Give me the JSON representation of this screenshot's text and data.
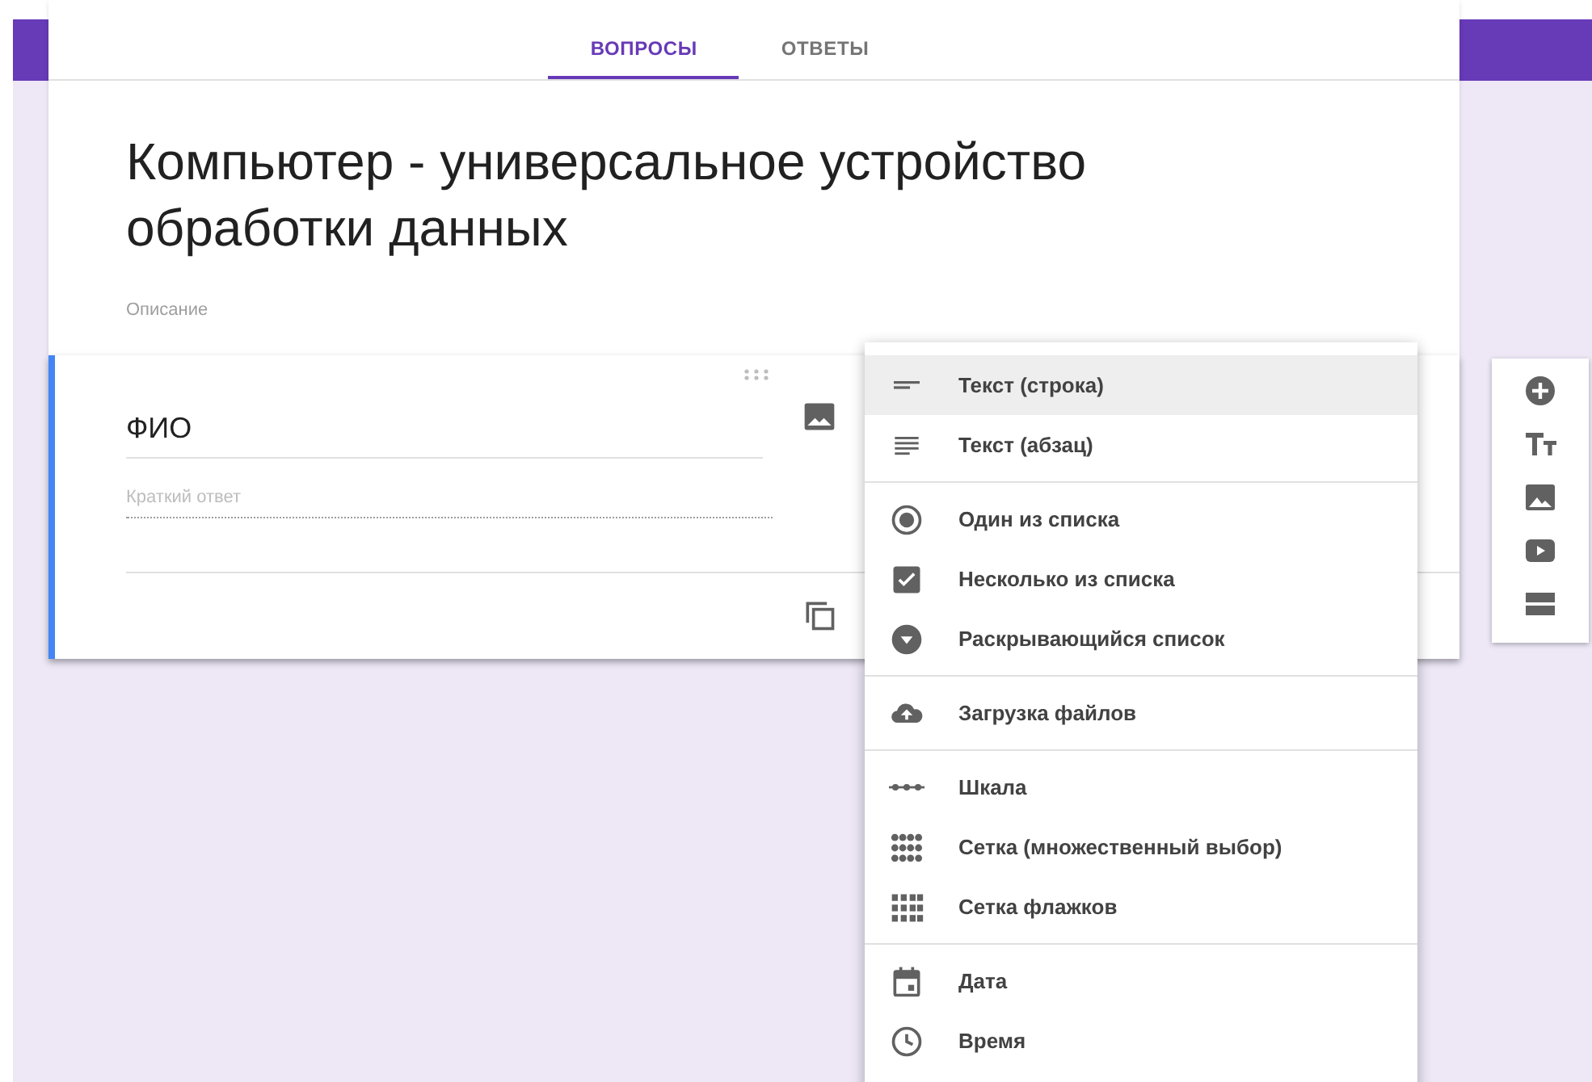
{
  "tabs": [
    {
      "label": "ВОПРОСЫ",
      "selected": true
    },
    {
      "label": "ОТВЕТЫ",
      "selected": false
    }
  ],
  "form": {
    "title": "Компьютер - универсальное устройство обработки данных",
    "description_placeholder": "Описание"
  },
  "question": {
    "title": "ФИО",
    "answer_placeholder": "Краткий ответ",
    "active": true
  },
  "type_menu": {
    "groups": [
      [
        {
          "kind": "short",
          "label": "Текст (строка)",
          "selected": true
        },
        {
          "kind": "paragraph",
          "label": "Текст (абзац)",
          "selected": false
        }
      ],
      [
        {
          "kind": "radio",
          "label": "Один из списка",
          "selected": false
        },
        {
          "kind": "checkbox",
          "label": "Несколько из списка",
          "selected": false
        },
        {
          "kind": "dropdown",
          "label": "Раскрывающийся список",
          "selected": false
        }
      ],
      [
        {
          "kind": "upload",
          "label": "Загрузка файлов",
          "selected": false
        }
      ],
      [
        {
          "kind": "scale",
          "label": "Шкала",
          "selected": false
        },
        {
          "kind": "grid",
          "label": "Сетка (множественный выбор)",
          "selected": false
        },
        {
          "kind": "checkgrid",
          "label": "Сетка флажков",
          "selected": false
        }
      ],
      [
        {
          "kind": "date",
          "label": "Дата",
          "selected": false
        },
        {
          "kind": "time",
          "label": "Время",
          "selected": false
        }
      ]
    ]
  },
  "side_toolbar": [
    {
      "kind": "add"
    },
    {
      "kind": "title"
    },
    {
      "kind": "image"
    },
    {
      "kind": "video"
    },
    {
      "kind": "section"
    }
  ]
}
